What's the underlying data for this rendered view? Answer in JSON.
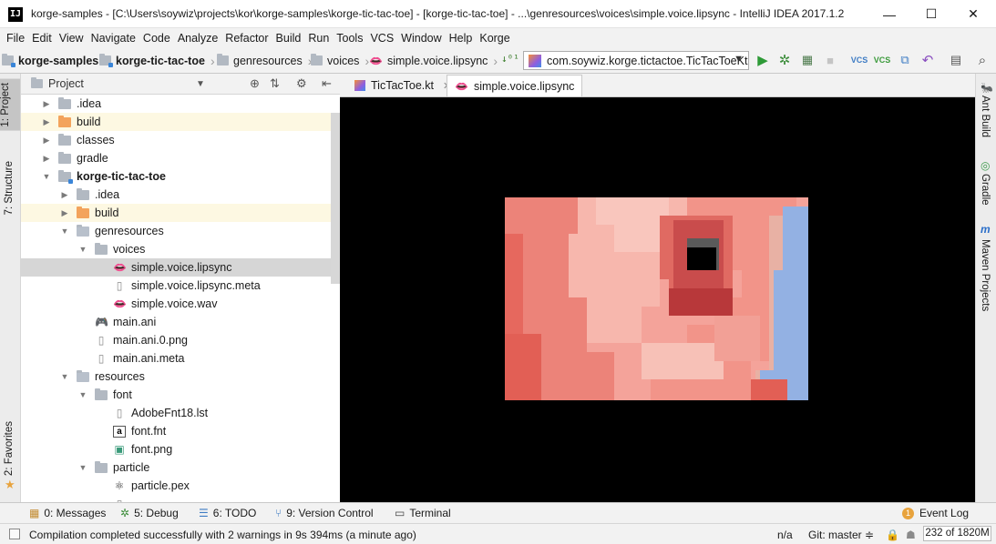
{
  "window": {
    "title": "korge-samples - [C:\\Users\\soywiz\\projects\\kor\\korge-samples\\korge-tic-tac-toe] - [korge-tic-tac-toe] - ...\\genresources\\voices\\simple.voice.lipsync - IntelliJ IDEA 2017.1.2",
    "app_icon_text": "IJ",
    "minimize": "—",
    "maximize": "☐",
    "close": "✕"
  },
  "menu": [
    "File",
    "Edit",
    "View",
    "Navigate",
    "Code",
    "Analyze",
    "Refactor",
    "Build",
    "Run",
    "Tools",
    "VCS",
    "Window",
    "Help",
    "Korge"
  ],
  "breadcrumbs": [
    {
      "label": "korge-samples",
      "icon": "folder-icon"
    },
    {
      "label": "korge-tic-tac-toe",
      "icon": "folder-icon"
    },
    {
      "label": "genresources",
      "icon": "folder-icon"
    },
    {
      "label": "voices",
      "icon": "folder-icon"
    },
    {
      "label": "simple.voice.lipsync",
      "icon": "lips-icon"
    }
  ],
  "run_config": {
    "label": "com.soywiz.korge.tictactoe.TicTacToeKt"
  },
  "toolbar_icons": [
    "run-icon",
    "debug-icon",
    "coverage-icon",
    "stop-icon",
    "vcs-update-icon",
    "vcs-commit-icon",
    "compare-icon",
    "revert-icon",
    "project-structure-icon",
    "search-everywhere-icon"
  ],
  "left_strip": {
    "project": "1: Project",
    "structure": "7: Structure",
    "favorites": "2: Favorites"
  },
  "right_strip": {
    "ant": "Ant Build",
    "gradle": "Gradle",
    "maven": "Maven Projects"
  },
  "project_panel": {
    "title": "Project"
  },
  "tree": [
    {
      "label": ".idea",
      "depth": 1,
      "toggle": "▶",
      "icon": "folder",
      "state": ""
    },
    {
      "label": "build",
      "depth": 1,
      "toggle": "▶",
      "icon": "folder-orange",
      "state": "hl"
    },
    {
      "label": "classes",
      "depth": 1,
      "toggle": "▶",
      "icon": "folder",
      "state": ""
    },
    {
      "label": "gradle",
      "depth": 1,
      "toggle": "▶",
      "icon": "folder",
      "state": ""
    },
    {
      "label": "korge-tic-tac-toe",
      "depth": 1,
      "toggle": "▼",
      "icon": "folder-module",
      "state": "",
      "bold": true
    },
    {
      "label": ".idea",
      "depth": 2,
      "toggle": "▶",
      "icon": "folder",
      "state": ""
    },
    {
      "label": "build",
      "depth": 2,
      "toggle": "▶",
      "icon": "folder-orange",
      "state": "hl"
    },
    {
      "label": "genresources",
      "depth": 2,
      "toggle": "▼",
      "icon": "folder-res",
      "state": ""
    },
    {
      "label": "voices",
      "depth": 3,
      "toggle": "▼",
      "icon": "folder",
      "state": ""
    },
    {
      "label": "simple.voice.lipsync",
      "depth": 4,
      "toggle": "",
      "icon": "lips",
      "state": "sel"
    },
    {
      "label": "simple.voice.lipsync.meta",
      "depth": 4,
      "toggle": "",
      "icon": "file",
      "state": ""
    },
    {
      "label": "simple.voice.wav",
      "depth": 4,
      "toggle": "",
      "icon": "lips",
      "state": ""
    },
    {
      "label": "main.ani",
      "depth": 3,
      "toggle": "",
      "icon": "gamepad",
      "state": ""
    },
    {
      "label": "main.ani.0.png",
      "depth": 3,
      "toggle": "",
      "icon": "file",
      "state": ""
    },
    {
      "label": "main.ani.meta",
      "depth": 3,
      "toggle": "",
      "icon": "file",
      "state": ""
    },
    {
      "label": "resources",
      "depth": 2,
      "toggle": "▼",
      "icon": "folder-res",
      "state": ""
    },
    {
      "label": "font",
      "depth": 3,
      "toggle": "▼",
      "icon": "folder",
      "state": ""
    },
    {
      "label": "AdobeFnt18.lst",
      "depth": 4,
      "toggle": "",
      "icon": "file",
      "state": ""
    },
    {
      "label": "font.fnt",
      "depth": 4,
      "toggle": "",
      "icon": "font",
      "state": ""
    },
    {
      "label": "font.png",
      "depth": 4,
      "toggle": "",
      "icon": "image",
      "state": ""
    },
    {
      "label": "particle",
      "depth": 3,
      "toggle": "▼",
      "icon": "folder",
      "state": ""
    },
    {
      "label": "particle.pex",
      "depth": 4,
      "toggle": "",
      "icon": "atom",
      "state": ""
    },
    {
      "label": "",
      "depth": 4,
      "toggle": "",
      "icon": "file",
      "state": ""
    }
  ],
  "editor_tabs": [
    {
      "label": "TicTacToe.kt",
      "icon": "kotlin",
      "active": false
    },
    {
      "label": "simple.voice.lipsync",
      "icon": "lips",
      "active": true
    }
  ],
  "tool_windows": [
    {
      "label": "0: Messages",
      "icon": "messages-icon"
    },
    {
      "label": "5: Debug",
      "icon": "debug-icon"
    },
    {
      "label": "6: TODO",
      "icon": "todo-icon"
    },
    {
      "label": "9: Version Control",
      "icon": "vcs-icon"
    },
    {
      "label": "Terminal",
      "icon": "terminal-icon"
    }
  ],
  "event_log": {
    "label": "Event Log",
    "count": "1"
  },
  "status": {
    "message": "Compilation completed successfully with 2 warnings in 9s 394ms (a minute ago)",
    "position": "n/a",
    "git": "Git: master ≑",
    "memory": "232 of 1820M"
  },
  "colors": {
    "lips": "#e0201c",
    "accent_folder": "#f3a35c",
    "selection": "#d6d6d6",
    "highlight": "#fdf8e2"
  }
}
